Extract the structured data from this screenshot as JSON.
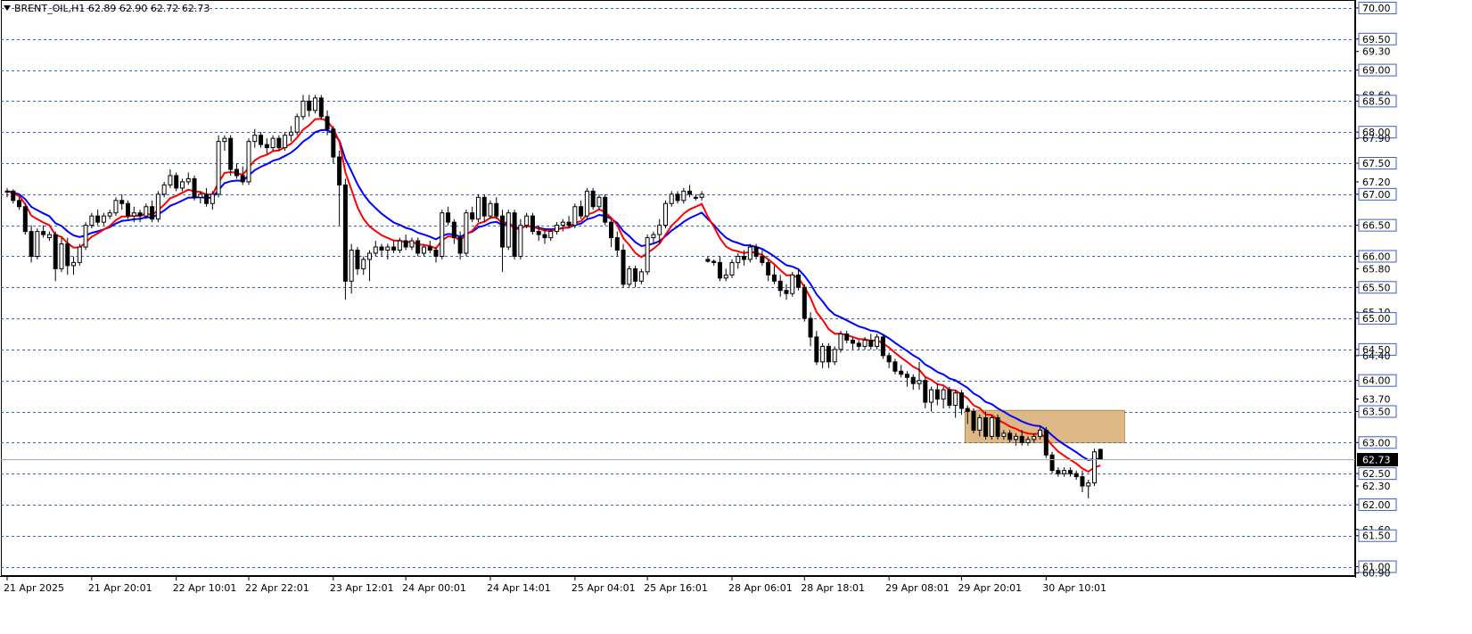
{
  "chart_data": {
    "type": "candlestick",
    "symbol_line": "BRENT_OIL,H1  62.89 62.90 62.72 62.73",
    "current_price": "62.73",
    "ylim": [
      60.85,
      70.1
    ],
    "grid_levels": [
      70.0,
      69.5,
      69.0,
      68.5,
      68.0,
      67.5,
      67.0,
      66.5,
      66.0,
      65.5,
      65.0,
      64.5,
      64.0,
      63.5,
      63.0,
      62.5,
      62.0,
      61.5,
      61.0
    ],
    "y_tick_labels": [
      {
        "v": 70.0,
        "t": "70.00",
        "boxed": true
      },
      {
        "v": 69.5,
        "t": "69.50",
        "boxed": true
      },
      {
        "v": 69.3,
        "t": "69.30",
        "boxed": false
      },
      {
        "v": 69.0,
        "t": "69.00",
        "boxed": true
      },
      {
        "v": 68.6,
        "t": "68.60",
        "boxed": false
      },
      {
        "v": 68.5,
        "t": "68.50",
        "boxed": true
      },
      {
        "v": 68.0,
        "t": "68.00",
        "boxed": true
      },
      {
        "v": 67.9,
        "t": "67.90",
        "boxed": false
      },
      {
        "v": 67.5,
        "t": "67.50",
        "boxed": true
      },
      {
        "v": 67.2,
        "t": "67.20",
        "boxed": false
      },
      {
        "v": 67.0,
        "t": "67.00",
        "boxed": true
      },
      {
        "v": 66.5,
        "t": "66.50",
        "boxed": true
      },
      {
        "v": 66.0,
        "t": "66.00",
        "boxed": true
      },
      {
        "v": 65.8,
        "t": "65.80",
        "boxed": false
      },
      {
        "v": 65.5,
        "t": "65.50",
        "boxed": true
      },
      {
        "v": 65.1,
        "t": "65.10",
        "boxed": false
      },
      {
        "v": 65.0,
        "t": "65.00",
        "boxed": true
      },
      {
        "v": 64.5,
        "t": "64.50",
        "boxed": true
      },
      {
        "v": 64.4,
        "t": "64.40",
        "boxed": false
      },
      {
        "v": 64.0,
        "t": "64.00",
        "boxed": true
      },
      {
        "v": 63.7,
        "t": "63.70",
        "boxed": false
      },
      {
        "v": 63.5,
        "t": "63.50",
        "boxed": true
      },
      {
        "v": 63.0,
        "t": "63.00",
        "boxed": true
      },
      {
        "v": 62.5,
        "t": "62.50",
        "boxed": true
      },
      {
        "v": 62.3,
        "t": "62.30",
        "boxed": false
      },
      {
        "v": 62.0,
        "t": "62.00",
        "boxed": true
      },
      {
        "v": 61.6,
        "t": "61.60",
        "boxed": false
      },
      {
        "v": 61.5,
        "t": "61.50",
        "boxed": true
      },
      {
        "v": 61.0,
        "t": "61.00",
        "boxed": true
      },
      {
        "v": 60.9,
        "t": "60.90",
        "boxed": false
      }
    ],
    "x_tick_labels": [
      {
        "i": 0,
        "t": "21 Apr 2025"
      },
      {
        "i": 14,
        "t": "21 Apr 20:01"
      },
      {
        "i": 28,
        "t": "22 Apr 10:01"
      },
      {
        "i": 40,
        "t": "22 Apr 22:01"
      },
      {
        "i": 54,
        "t": "23 Apr 12:01"
      },
      {
        "i": 66,
        "t": "24 Apr 00:01"
      },
      {
        "i": 80,
        "t": "24 Apr 14:01"
      },
      {
        "i": 94,
        "t": "25 Apr 04:01"
      },
      {
        "i": 106,
        "t": "25 Apr 16:01"
      },
      {
        "i": 120,
        "t": "28 Apr 06:01"
      },
      {
        "i": 132,
        "t": "28 Apr 18:01"
      },
      {
        "i": 146,
        "t": "29 Apr 08:01"
      },
      {
        "i": 158,
        "t": "29 Apr 20:01"
      },
      {
        "i": 172,
        "t": "30 Apr 10:01"
      }
    ],
    "candles": [
      [
        67.05,
        67.1,
        66.95,
        67.05
      ],
      [
        67.05,
        67.08,
        66.85,
        66.9
      ],
      [
        66.9,
        66.95,
        66.75,
        66.8
      ],
      [
        66.8,
        66.85,
        66.35,
        66.4
      ],
      [
        66.4,
        66.5,
        65.9,
        66.0
      ],
      [
        66.0,
        66.45,
        65.95,
        66.4
      ],
      [
        66.4,
        66.5,
        66.3,
        66.35
      ],
      [
        66.3,
        66.4,
        66.25,
        66.35
      ],
      [
        66.35,
        66.4,
        65.6,
        65.8
      ],
      [
        65.8,
        66.3,
        65.75,
        66.2
      ],
      [
        66.2,
        66.3,
        65.7,
        65.85
      ],
      [
        65.85,
        66.0,
        65.7,
        65.9
      ],
      [
        65.9,
        66.2,
        65.85,
        66.15
      ],
      [
        66.15,
        66.55,
        66.1,
        66.5
      ],
      [
        66.5,
        66.7,
        66.45,
        66.65
      ],
      [
        66.65,
        66.75,
        66.5,
        66.55
      ],
      [
        66.55,
        66.7,
        66.5,
        66.65
      ],
      [
        66.65,
        66.75,
        66.6,
        66.7
      ],
      [
        66.7,
        66.95,
        66.65,
        66.9
      ],
      [
        66.9,
        67.0,
        66.75,
        66.85
      ],
      [
        66.85,
        66.9,
        66.6,
        66.65
      ],
      [
        66.65,
        66.8,
        66.55,
        66.7
      ],
      [
        66.7,
        66.75,
        66.55,
        66.65
      ],
      [
        66.65,
        66.85,
        66.6,
        66.8
      ],
      [
        66.8,
        66.9,
        66.55,
        66.6
      ],
      [
        66.6,
        67.05,
        66.55,
        67.0
      ],
      [
        67.0,
        67.2,
        66.95,
        67.15
      ],
      [
        67.15,
        67.4,
        67.1,
        67.3
      ],
      [
        67.3,
        67.35,
        67.05,
        67.1
      ],
      [
        67.1,
        67.25,
        67.05,
        67.2
      ],
      [
        67.2,
        67.35,
        67.15,
        67.25
      ],
      [
        67.25,
        67.3,
        66.9,
        66.95
      ],
      [
        66.95,
        67.05,
        66.85,
        67.0
      ],
      [
        67.0,
        67.1,
        66.8,
        66.85
      ],
      [
        66.85,
        67.05,
        66.75,
        67.0
      ],
      [
        67.0,
        67.95,
        66.95,
        67.85
      ],
      [
        67.85,
        67.95,
        67.7,
        67.9
      ],
      [
        67.9,
        67.95,
        67.3,
        67.4
      ],
      [
        67.4,
        67.5,
        67.25,
        67.3
      ],
      [
        67.3,
        67.45,
        67.15,
        67.2
      ],
      [
        67.2,
        67.9,
        67.15,
        67.85
      ],
      [
        67.85,
        68.05,
        67.75,
        67.95
      ],
      [
        67.95,
        68.0,
        67.75,
        67.8
      ],
      [
        67.8,
        67.9,
        67.65,
        67.75
      ],
      [
        67.75,
        67.95,
        67.7,
        67.9
      ],
      [
        67.9,
        67.95,
        67.7,
        67.75
      ],
      [
        67.75,
        68.0,
        67.7,
        67.95
      ],
      [
        67.95,
        68.1,
        67.85,
        68.0
      ],
      [
        68.0,
        68.3,
        67.95,
        68.25
      ],
      [
        68.25,
        68.6,
        68.2,
        68.5
      ],
      [
        68.5,
        68.6,
        68.25,
        68.35
      ],
      [
        68.35,
        68.6,
        68.3,
        68.55
      ],
      [
        68.55,
        68.6,
        68.2,
        68.25
      ],
      [
        68.25,
        68.35,
        67.95,
        68.05
      ],
      [
        68.05,
        68.1,
        67.5,
        67.6
      ],
      [
        67.6,
        67.7,
        66.5,
        67.15
      ],
      [
        67.15,
        67.25,
        65.3,
        65.6
      ],
      [
        65.6,
        66.2,
        65.4,
        66.1
      ],
      [
        66.1,
        66.15,
        65.7,
        65.8
      ],
      [
        65.8,
        66.0,
        65.7,
        65.95
      ],
      [
        65.95,
        66.1,
        65.6,
        66.05
      ],
      [
        66.05,
        66.25,
        66.0,
        66.15
      ],
      [
        66.15,
        66.2,
        66.0,
        66.1
      ],
      [
        66.1,
        66.2,
        65.95,
        66.15
      ],
      [
        66.15,
        66.25,
        66.05,
        66.1
      ],
      [
        66.1,
        66.3,
        66.05,
        66.25
      ],
      [
        66.25,
        66.35,
        66.1,
        66.15
      ],
      [
        66.15,
        66.3,
        66.1,
        66.25
      ],
      [
        66.25,
        66.3,
        66.0,
        66.05
      ],
      [
        66.05,
        66.2,
        66.0,
        66.15
      ],
      [
        66.15,
        66.25,
        66.05,
        66.1
      ],
      [
        66.1,
        66.15,
        65.9,
        66.0
      ],
      [
        66.0,
        66.75,
        65.95,
        66.7
      ],
      [
        66.7,
        66.8,
        66.5,
        66.55
      ],
      [
        66.55,
        66.6,
        66.2,
        66.3
      ],
      [
        66.3,
        66.4,
        65.95,
        66.05
      ],
      [
        66.05,
        66.75,
        66.0,
        66.7
      ],
      [
        66.7,
        66.8,
        66.55,
        66.6
      ],
      [
        66.6,
        67.0,
        66.55,
        66.95
      ],
      [
        66.95,
        67.0,
        66.55,
        66.65
      ],
      [
        66.65,
        66.9,
        66.6,
        66.85
      ],
      [
        66.85,
        66.95,
        66.6,
        66.65
      ],
      [
        66.65,
        66.75,
        65.75,
        66.15
      ],
      [
        66.15,
        66.75,
        66.1,
        66.7
      ],
      [
        66.7,
        66.75,
        65.95,
        66.0
      ],
      [
        66.0,
        66.6,
        65.95,
        66.5
      ],
      [
        66.5,
        66.7,
        66.45,
        66.65
      ],
      [
        66.65,
        66.7,
        66.35,
        66.4
      ],
      [
        66.4,
        66.5,
        66.25,
        66.35
      ],
      [
        66.35,
        66.45,
        66.2,
        66.3
      ],
      [
        66.3,
        66.45,
        66.25,
        66.4
      ],
      [
        66.4,
        66.55,
        66.35,
        66.5
      ],
      [
        66.5,
        66.6,
        66.4,
        66.55
      ],
      [
        66.55,
        66.65,
        66.45,
        66.5
      ],
      [
        66.5,
        66.85,
        66.45,
        66.8
      ],
      [
        66.8,
        66.9,
        66.6,
        66.65
      ],
      [
        66.65,
        67.1,
        66.6,
        67.05
      ],
      [
        67.05,
        67.1,
        66.75,
        66.8
      ],
      [
        66.8,
        67.0,
        66.75,
        66.95
      ],
      [
        66.95,
        67.0,
        66.5,
        66.55
      ],
      [
        66.55,
        66.6,
        66.15,
        66.3
      ],
      [
        66.3,
        66.4,
        66.0,
        66.1
      ],
      [
        66.1,
        66.2,
        65.5,
        65.55
      ],
      [
        65.55,
        65.85,
        65.5,
        65.8
      ],
      [
        65.8,
        65.85,
        65.5,
        65.6
      ],
      [
        65.6,
        65.8,
        65.55,
        65.75
      ],
      [
        65.75,
        66.35,
        65.7,
        66.3
      ],
      [
        66.3,
        66.4,
        66.2,
        66.35
      ],
      [
        66.35,
        66.6,
        66.2,
        66.5
      ],
      [
        66.5,
        66.9,
        66.45,
        66.85
      ],
      [
        66.85,
        67.05,
        66.8,
        67.0
      ],
      [
        67.0,
        67.05,
        66.85,
        66.9
      ],
      [
        66.9,
        67.1,
        66.85,
        67.05
      ],
      [
        67.05,
        67.15,
        66.95,
        67.0
      ],
      [
        66.95,
        67.0,
        66.9,
        66.95
      ],
      [
        66.95,
        67.05,
        66.9,
        67.0
      ],
      [
        65.95,
        66.0,
        65.9,
        65.92
      ],
      [
        65.92,
        65.95,
        65.85,
        65.9
      ],
      [
        65.9,
        66.0,
        65.6,
        65.65
      ],
      [
        65.65,
        65.8,
        65.6,
        65.7
      ],
      [
        65.7,
        65.95,
        65.65,
        65.9
      ],
      [
        65.9,
        66.05,
        65.8,
        66.0
      ],
      [
        66.0,
        66.1,
        65.85,
        65.95
      ],
      [
        65.95,
        66.2,
        65.9,
        66.15
      ],
      [
        66.15,
        66.2,
        65.95,
        66.0
      ],
      [
        66.0,
        66.1,
        65.85,
        65.9
      ],
      [
        65.9,
        65.95,
        65.6,
        65.7
      ],
      [
        65.7,
        65.85,
        65.55,
        65.6
      ],
      [
        65.6,
        65.7,
        65.35,
        65.45
      ],
      [
        65.45,
        65.55,
        65.3,
        65.4
      ],
      [
        65.4,
        65.75,
        65.35,
        65.7
      ],
      [
        65.7,
        65.8,
        65.45,
        65.5
      ],
      [
        65.5,
        65.55,
        64.95,
        65.0
      ],
      [
        65.0,
        65.1,
        64.55,
        64.7
      ],
      [
        64.7,
        64.8,
        64.25,
        64.3
      ],
      [
        64.3,
        64.6,
        64.2,
        64.55
      ],
      [
        64.55,
        64.6,
        64.2,
        64.3
      ],
      [
        64.3,
        64.55,
        64.25,
        64.5
      ],
      [
        64.5,
        64.8,
        64.45,
        64.75
      ],
      [
        64.75,
        64.8,
        64.6,
        64.65
      ],
      [
        64.65,
        64.7,
        64.5,
        64.6
      ],
      [
        64.6,
        64.65,
        64.5,
        64.55
      ],
      [
        64.55,
        64.7,
        64.5,
        64.65
      ],
      [
        64.65,
        64.75,
        64.5,
        64.55
      ],
      [
        64.55,
        64.75,
        64.5,
        64.7
      ],
      [
        64.7,
        64.75,
        64.35,
        64.4
      ],
      [
        64.4,
        64.45,
        64.2,
        64.3
      ],
      [
        64.3,
        64.35,
        64.1,
        64.15
      ],
      [
        64.15,
        64.25,
        64.05,
        64.1
      ],
      [
        64.1,
        64.15,
        63.9,
        64.05
      ],
      [
        64.05,
        64.1,
        63.85,
        63.95
      ],
      [
        63.95,
        64.3,
        63.85,
        64.0
      ],
      [
        64.0,
        64.05,
        63.55,
        63.65
      ],
      [
        63.65,
        63.9,
        63.5,
        63.85
      ],
      [
        63.85,
        63.95,
        63.6,
        63.7
      ],
      [
        63.7,
        63.9,
        63.55,
        63.85
      ],
      [
        63.85,
        63.9,
        63.55,
        63.6
      ],
      [
        63.6,
        63.85,
        63.4,
        63.8
      ],
      [
        63.8,
        63.85,
        63.45,
        63.55
      ],
      [
        63.55,
        63.6,
        63.3,
        63.5
      ],
      [
        63.5,
        63.55,
        63.15,
        63.2
      ],
      [
        63.2,
        63.45,
        63.1,
        63.4
      ],
      [
        63.4,
        63.5,
        63.05,
        63.1
      ],
      [
        63.1,
        63.45,
        63.05,
        63.4
      ],
      [
        63.4,
        63.45,
        63.05,
        63.1
      ],
      [
        63.1,
        63.2,
        63.05,
        63.15
      ],
      [
        63.15,
        63.2,
        63.0,
        63.05
      ],
      [
        63.05,
        63.15,
        62.95,
        63.1
      ],
      [
        63.1,
        63.2,
        62.95,
        63.0
      ],
      [
        63.0,
        63.1,
        62.95,
        63.05
      ],
      [
        63.05,
        63.15,
        63.0,
        63.1
      ],
      [
        63.1,
        63.25,
        63.05,
        63.2
      ],
      [
        63.2,
        63.25,
        62.75,
        62.8
      ],
      [
        62.8,
        62.85,
        62.5,
        62.55
      ],
      [
        62.55,
        62.6,
        62.45,
        62.5
      ],
      [
        62.5,
        62.6,
        62.45,
        62.55
      ],
      [
        62.55,
        62.6,
        62.45,
        62.5
      ],
      [
        62.5,
        62.55,
        62.4,
        62.45
      ],
      [
        62.45,
        62.55,
        62.2,
        62.3
      ],
      [
        62.3,
        62.4,
        62.1,
        62.35
      ],
      [
        62.35,
        62.9,
        62.3,
        62.85
      ],
      [
        62.89,
        62.9,
        62.72,
        62.73
      ]
    ],
    "ma_fast": {
      "name": "",
      "color": "#ff0000",
      "period": 8
    },
    "ma_slow": {
      "name": "",
      "color": "#0000ff",
      "period": 14
    },
    "zone": {
      "from_index": 159,
      "to_index": 185,
      "low": 63.0,
      "high": 63.52,
      "color": "#deb887"
    }
  }
}
